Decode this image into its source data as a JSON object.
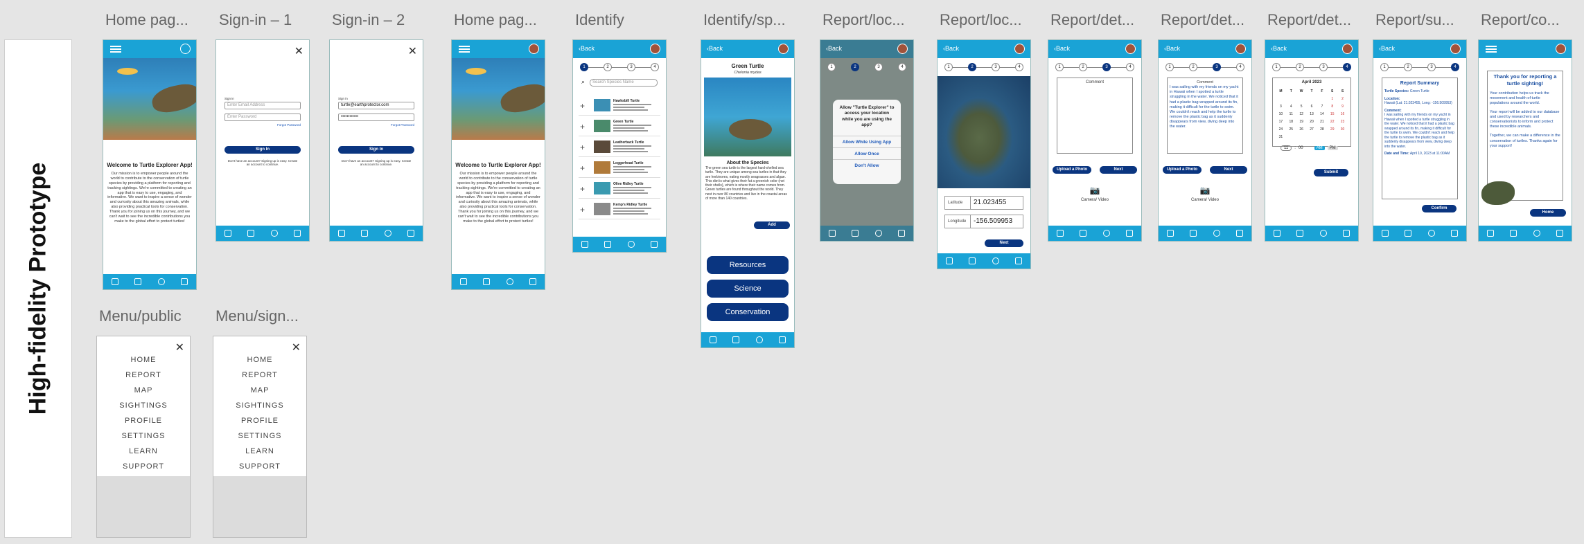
{
  "side_label": "High-fidelity Prototype",
  "frames": {
    "home1": {
      "title": "Home pag...",
      "heading": "Welcome to Turtle Explorer App!",
      "body": "Our mission is to empower people around the world to contribute to the conservation of turtle species by providing a platform for reporting and tracking sightings.  We're committed to creating an app that is easy to use, engaging, and informative. We want to inspire a sense of wonder and curiosity about this amazing animals, while also providing practical tools for conservation. Thank you for joining us on this journey, and we can't wait to see the incredible contributions you make to the global effort to protect turtles!"
    },
    "signin1": {
      "title": "Sign-in – 1",
      "email_placeholder": "Enter Email Address",
      "password_placeholder": "Enter Password",
      "forgot": "Forgot Password",
      "button": "Sign In",
      "footer": "Don't have an account? Signing up is easy. Create an account to continue."
    },
    "signin2": {
      "title": "Sign-in – 2",
      "email_value": "turtle@earthprotector.com",
      "password_value": "••••••••••••",
      "forgot": "Forgot Password",
      "button": "Sign In",
      "footer": "Don't have an account? Signing up is easy. Create an account to continue."
    },
    "home2": {
      "title": "Home pag...",
      "heading": "Welcome to Turtle Explorer App!",
      "body": "Our mission is to empower people around the world to contribute to the conservation of turtle species by providing a platform for reporting and tracking sightings.  We're committed to creating an app that is easy to use, engaging, and informative. We want to inspire a sense of wonder and curiosity about this amazing animals, while also providing practical tools for conservation. Thank you for joining us on this journey, and we can't wait to see the incredible contributions you make to the global effort to protect turtles!"
    },
    "identify": {
      "title": "Identify",
      "back": "Back",
      "search_placeholder": "Search Species Name",
      "species": [
        "Hawksbill Turtle",
        "Green Turtle",
        "Leatherback Turtle",
        "Loggerhead Turtle",
        "Olive Ridley Turtle",
        "Kemp's Ridley Turtle"
      ]
    },
    "identify_sp": {
      "title": "Identify/sp...",
      "back": "Back",
      "name": "Green Turtle",
      "latin": "Chelonia mydas",
      "about": "About the Species",
      "text": "The green sea turtle is the largest hard-shelled sea turtle. They are unique among sea turtles in that they are herbivores, eating mostly seagrasses and algae. This diet is what gives their fat a greenish color (not their shells), which is where their name comes from.  Green turtles are found throughout the world. They nest in over 80 countries and live in the coastal areas of more than 140 countries.",
      "add": "Add",
      "resources": "Resources",
      "science": "Science",
      "conservation": "Conservation"
    },
    "report_loc1": {
      "title": "Report/loc...",
      "back": "Back",
      "dialog_title": "Allow \"Turtle Explorer\" to access your location while you are using the app?",
      "opt1": "Allow While Using App",
      "opt2": "Allow Once",
      "opt3": "Don't Allow"
    },
    "report_loc2": {
      "title": "Report/loc...",
      "back": "Back",
      "lat_label": "Latitude",
      "lat_value": "21.023455",
      "lon_label": "Longitude",
      "lon_value": "-156.509953",
      "next": "Next"
    },
    "report_det1": {
      "title": "Report/det...",
      "back": "Back",
      "comment_label": "Comment",
      "upload": "Upload a Photo",
      "next": "Next",
      "camera": "Camera/ Video"
    },
    "report_det2": {
      "title": "Report/det...",
      "back": "Back",
      "comment_label": "Comment",
      "comment": "I was sailing with my friends on my yacht in Hawaii when I spotted a turtle struggling in the water. We noticed that it had a plastic bag wrapped around its fin, making it difficult for the turtle to swim.  We couldn't reach and help the turtle to remove the plastic bag as it suddenly disappears from view, diving deep into the water.",
      "upload": "Upload a Photo",
      "next": "Next",
      "camera": "Camera/ Video"
    },
    "report_det3": {
      "title": "Report/det...",
      "back": "Back",
      "month": "April 2023",
      "weekdays": [
        "M",
        "T",
        "W",
        "T",
        "F",
        "S",
        "S"
      ],
      "days": [
        "",
        "",
        "",
        "",
        "",
        "1",
        "2",
        "3",
        "4",
        "5",
        "6",
        "7",
        "8",
        "9",
        "10",
        "11",
        "12",
        "13",
        "14",
        "15",
        "16",
        "17",
        "18",
        "19",
        "20",
        "21",
        "22",
        "23",
        "24",
        "25",
        "26",
        "27",
        "28",
        "29",
        "30",
        "31"
      ],
      "hour": "11",
      "minute": "00",
      "am": "AM",
      "pm": "PM",
      "submit": "Submit"
    },
    "report_sum": {
      "title": "Report/su...",
      "back": "Back",
      "heading": "Report Summary",
      "species_label": "Turtle Species:",
      "species": "Green Turtle",
      "location_label": "Location:",
      "location": "Hawaii (Lat: 21.023455, Long: -156.509953)",
      "comment_label": "Comment:",
      "comment": "I was sailing with my friends on my yacht in Hawaii when I spotted a turtle struggling in the water. We noticed that it had a plastic bag wrapped around its fin, making it difficult for the turtle to swim.  We couldn't reach and help the turtle to remove the plastic bag as it suddenly disappears from view, diving deep into the water.",
      "datetime_label": "Date and Time:",
      "datetime": "April 10, 2023 at 11:00AM",
      "confirm": "Confirm"
    },
    "report_conf": {
      "title": "Report/co...",
      "heading": "Thank you for reporting a turtle sighting!",
      "p1": "Your contribution helps us track the movement and health of turtle populations around the world.",
      "p2": "Your report will be added to our database and used by researchers and conservationists to inform and protect these incredible animals.",
      "p3": "Together, we can make a difference in the conservation of turtles. Thanks again for your support!",
      "home": "Home"
    },
    "menu_public": {
      "title": "Menu/public",
      "items": [
        "HOME",
        "REPORT",
        "MAP",
        "SIGHTINGS",
        "PROFILE",
        "SETTINGS",
        "LEARN",
        "SUPPORT"
      ]
    },
    "menu_signed": {
      "title": "Menu/sign...",
      "items": [
        "HOME",
        "REPORT",
        "MAP",
        "SIGHTINGS",
        "PROFILE",
        "SETTINGS",
        "LEARN",
        "SUPPORT"
      ]
    }
  },
  "colors": {
    "topbar": "#1aa3d6",
    "primary_button": "#0a3580",
    "canvas": "#e5e5e5"
  },
  "icons": [
    "menu-icon",
    "profile-icon",
    "close-icon",
    "back-icon",
    "search-icon",
    "plus-icon",
    "camera-icon",
    "home-icon",
    "document-icon",
    "location-icon",
    "card-icon"
  ]
}
